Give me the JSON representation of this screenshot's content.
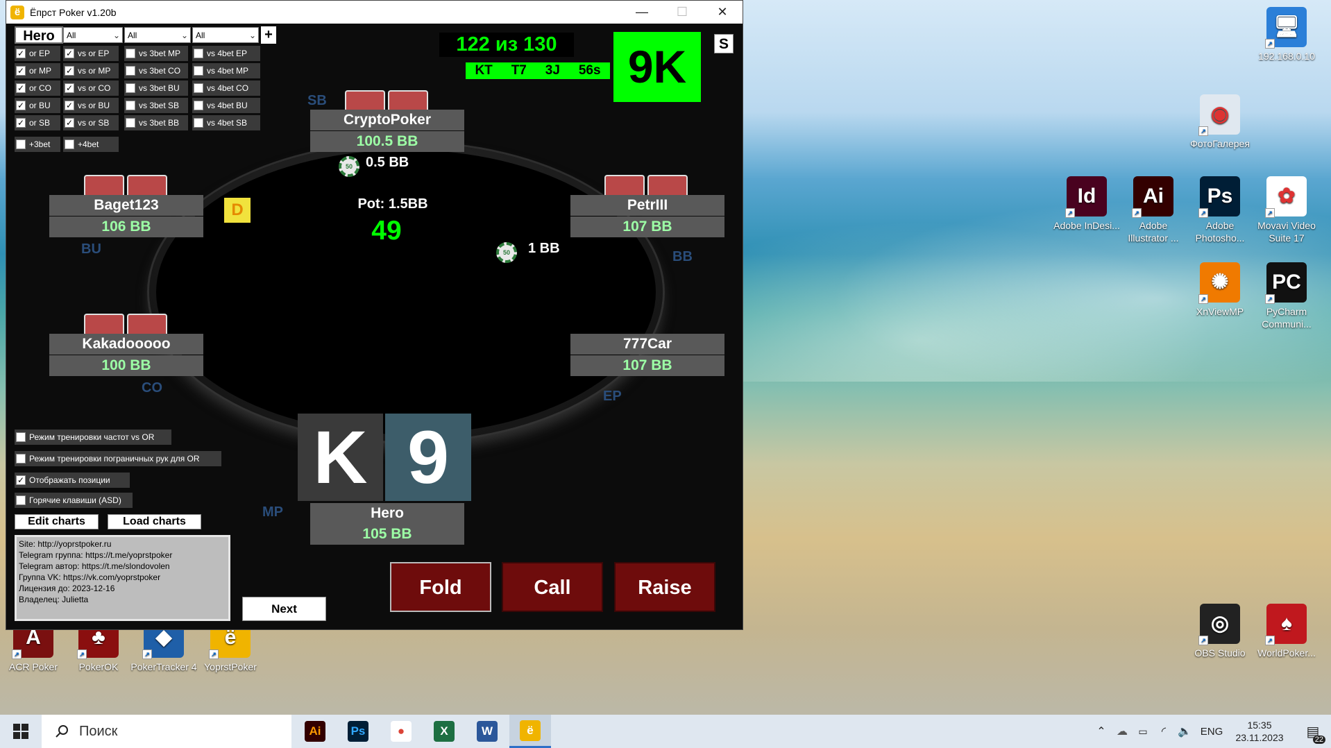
{
  "window": {
    "title": "Ёпрст Poker v1.20b",
    "logo_char": "ё",
    "min": "—",
    "max": "☐",
    "close": "✕"
  },
  "filters": {
    "hero_label": "Hero",
    "add_label": "+",
    "dropdowns": [
      "All",
      "All",
      "All"
    ],
    "col1": [
      {
        "label": "or EP",
        "checked": true
      },
      {
        "label": "or MP",
        "checked": true
      },
      {
        "label": "or CO",
        "checked": true
      },
      {
        "label": "or BU",
        "checked": true
      },
      {
        "label": "or SB",
        "checked": true
      }
    ],
    "col2": [
      {
        "label": "vs or EP",
        "checked": true
      },
      {
        "label": "vs or MP",
        "checked": true
      },
      {
        "label": "vs or CO",
        "checked": true
      },
      {
        "label": "vs or BU",
        "checked": true
      },
      {
        "label": "vs or SB",
        "checked": true
      }
    ],
    "col3": [
      {
        "label": "vs 3bet MP",
        "checked": false
      },
      {
        "label": "vs 3bet CO",
        "checked": false
      },
      {
        "label": "vs 3bet BU",
        "checked": false
      },
      {
        "label": "vs 3bet SB",
        "checked": false
      },
      {
        "label": "vs 3bet BB",
        "checked": false
      }
    ],
    "col4": [
      {
        "label": "vs 4bet EP",
        "checked": false
      },
      {
        "label": "vs 4bet MP",
        "checked": false
      },
      {
        "label": "vs 4bet CO",
        "checked": false
      },
      {
        "label": "vs 4bet BU",
        "checked": false
      },
      {
        "label": "vs 4bet SB",
        "checked": false
      }
    ],
    "extra": [
      {
        "label": "+3bet",
        "checked": false
      },
      {
        "label": "+4bet",
        "checked": false
      }
    ]
  },
  "score": {
    "counter": "122 из 130",
    "history": [
      "KT",
      "T7",
      "3J",
      "56s"
    ],
    "current_hand": "9K",
    "s_button": "S"
  },
  "table": {
    "pot_label": "Pot: 1.5BB",
    "timer": "49",
    "dealer": "D",
    "players": {
      "sb": {
        "name": "CryptoPoker",
        "stack": "100.5 BB",
        "pos": "SB",
        "bet": "0.5 BB"
      },
      "bu": {
        "name": "Baget123",
        "stack": "106 BB",
        "pos": "BU"
      },
      "bb": {
        "name": "PetrIII",
        "stack": "107 BB",
        "pos": "BB",
        "bet": "1 BB"
      },
      "co": {
        "name": "Kakadooooo",
        "stack": "100 BB",
        "pos": "CO"
      },
      "ep": {
        "name": "777Car",
        "stack": "107 BB",
        "pos": "EP"
      },
      "hero": {
        "name": "Hero",
        "stack": "105 BB",
        "pos": "MP",
        "card1": "K",
        "card2": "9"
      }
    },
    "chip_label": "50"
  },
  "options": [
    {
      "label": "Режим тренировки частот vs OR",
      "checked": false
    },
    {
      "label": "Режим тренировки пограничных рук для OR",
      "checked": false
    },
    {
      "label": "Отображать позиции",
      "checked": true
    },
    {
      "label": "Горячие клавиши (ASD)",
      "checked": false
    }
  ],
  "buttons": {
    "edit_charts": "Edit charts",
    "load_charts": "Load charts",
    "next": "Next",
    "fold": "Fold",
    "call": "Call",
    "raise": "Raise"
  },
  "info_lines": [
    "Site: http://yoprstpoker.ru",
    "Telegram группа: https://t.me/yoprstpoker",
    "Telegram автор: https://t.me/slondovolen",
    "Группа VK: https://vk.com/yoprstpoker",
    "Лицензия до: 2023-12-16",
    "Владелец: Julietta"
  ],
  "desktop_icons": [
    {
      "label": "192.168.0.10",
      "glyph": "🖥",
      "color": "#2b7fd8"
    },
    {
      "label": "ФотоГалерея",
      "glyph": "◉",
      "color": "#e0e8f0"
    },
    {
      "label": "Adobe InDesi...",
      "glyph": "Id",
      "color": "#49021f"
    },
    {
      "label": "Adobe Illustrator ...",
      "glyph": "Ai",
      "color": "#330000"
    },
    {
      "label": "Adobe Photosho...",
      "glyph": "Ps",
      "color": "#001e36"
    },
    {
      "label": "Movavi Video Suite 17",
      "glyph": "✿",
      "color": "#ffffff"
    },
    {
      "label": "XnViewMP",
      "glyph": "✺",
      "color": "#f07a00"
    },
    {
      "label": "PyCharm Communi...",
      "glyph": "PC",
      "color": "#111111"
    },
    {
      "label": "OBS Studio",
      "glyph": "◎",
      "color": "#222222"
    },
    {
      "label": "WorldPoker...",
      "glyph": "♠",
      "color": "#c0181e"
    },
    {
      "label": "ACR Poker",
      "glyph": "A",
      "color": "#7a1010"
    },
    {
      "label": "PokerOK",
      "glyph": "♣",
      "color": "#8a0f0f"
    },
    {
      "label": "PokerTracker 4",
      "glyph": "◆",
      "color": "#1f5fa8"
    },
    {
      "label": "YoprstPoker",
      "glyph": "ё",
      "color": "#f0b400"
    }
  ],
  "taskbar": {
    "search_placeholder": "Поиск",
    "lang": "ENG",
    "time": "15:35",
    "date": "23.11.2023",
    "notif_count": "22",
    "apps": [
      {
        "name": "illustrator",
        "glyph": "Ai",
        "color": "#330000",
        "fg": "#ff9a00"
      },
      {
        "name": "photoshop",
        "glyph": "Ps",
        "color": "#001e36",
        "fg": "#31a8ff"
      },
      {
        "name": "chrome",
        "glyph": "●",
        "color": "#ffffff",
        "fg": "#db4437"
      },
      {
        "name": "excel",
        "glyph": "X",
        "color": "#1d6f42",
        "fg": "#ffffff"
      },
      {
        "name": "word",
        "glyph": "W",
        "color": "#2b579a",
        "fg": "#ffffff"
      },
      {
        "name": "yoprst",
        "glyph": "ё",
        "color": "#f0b400",
        "fg": "#ffffff"
      }
    ]
  },
  "colors": {
    "green_accent": "#00ff00",
    "action_red": "#6e0c0c",
    "stack_green": "#9dffa6",
    "pos_blue": "#2a4d7a"
  }
}
